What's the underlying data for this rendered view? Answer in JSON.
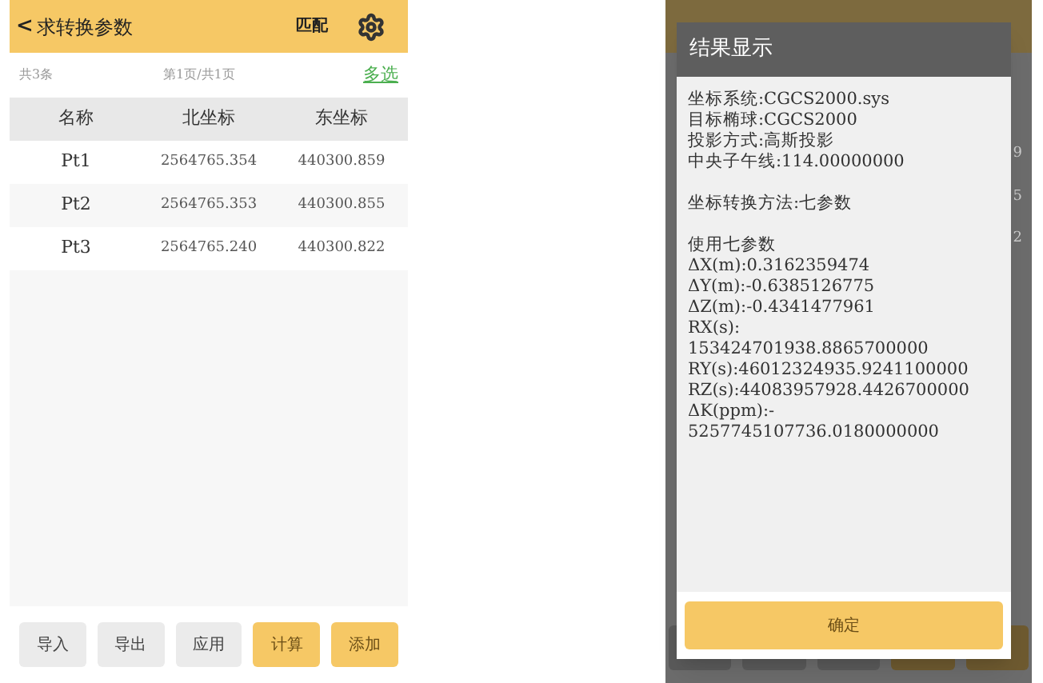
{
  "header": {
    "back_glyph": "<",
    "title": "求转换参数",
    "match": "匹配"
  },
  "info_bar": {
    "count": "共3条",
    "page": "第1页/共1页",
    "multi_select": "多选"
  },
  "table": {
    "columns": [
      "名称",
      "北坐标",
      "东坐标"
    ],
    "rows": [
      [
        "Pt1",
        "2564765.354",
        "440300.859"
      ],
      [
        "Pt2",
        "2564765.353",
        "440300.855"
      ],
      [
        "Pt3",
        "2564765.240",
        "440300.822"
      ]
    ]
  },
  "buttons": [
    {
      "label": "导入",
      "kind": "plain"
    },
    {
      "label": "导出",
      "kind": "plain"
    },
    {
      "label": "应用",
      "kind": "plain"
    },
    {
      "label": "计算",
      "kind": "primary"
    },
    {
      "label": "添加",
      "kind": "primary"
    }
  ],
  "background_cells": [
    "9",
    "5",
    "2"
  ],
  "dialog": {
    "title": "结果显示",
    "sections": [
      [
        "坐标系统:CGCS2000.sys",
        "目标椭球:CGCS2000",
        "投影方式:高斯投影",
        "中央子午线:114.00000000"
      ],
      [
        "坐标转换方法:七参数"
      ],
      [
        "使用七参数",
        "ΔX(m):0.3162359474",
        "ΔY(m):-0.6385126775",
        "ΔZ(m):-0.4341477961",
        "RX(s):",
        "153424701938.8865700000",
        "RY(s):46012324935.9241100000",
        "RZ(s):44083957928.4426700000",
        "ΔK(ppm):-",
        "5257745107736.0180000000"
      ]
    ],
    "confirm": "确定"
  }
}
